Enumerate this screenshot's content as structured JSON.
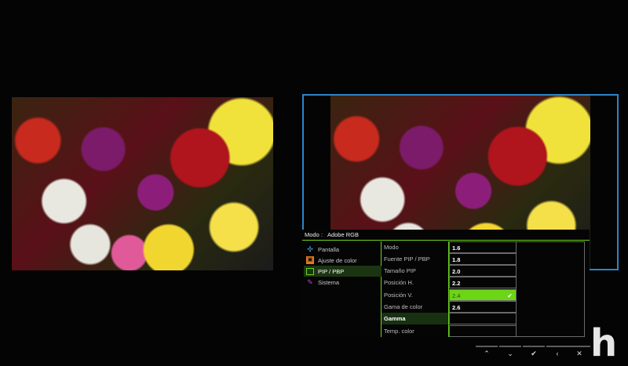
{
  "osd": {
    "mode_label": "Modo :",
    "mode_value": "Adobe RGB",
    "categories": [
      {
        "label": "Pantalla",
        "icon": "move-icon",
        "color": "#3ea6e8"
      },
      {
        "label": "Ajuste de color",
        "icon": "color-adjust-icon",
        "color": "#e07a1e"
      },
      {
        "label": "PIP / PBP",
        "icon": "pip-icon",
        "color": "#6bd51b"
      },
      {
        "label": "Sistema",
        "icon": "wrench-icon",
        "color": "#c040c8"
      }
    ],
    "submenu": [
      "Modo",
      "Fuente PIP / PBP",
      "Tamaño PIP",
      "Posición H.",
      "Posición V.",
      "Gama de color",
      "Gamma",
      "Temp. color"
    ],
    "values": [
      "1.6",
      "1.8",
      "2.0",
      "2.2",
      "2.4",
      "2.6"
    ],
    "selected_value": "2.4",
    "checkmark": "✔"
  },
  "nav_buttons": [
    {
      "glyph": "⌃"
    },
    {
      "glyph": "⌄"
    },
    {
      "glyph": "✔"
    },
    {
      "glyph": "‹"
    },
    {
      "glyph": "✕"
    }
  ],
  "watermark": "h",
  "colors": {
    "accent_green": "#6bd51b",
    "pip_border": "#2a86c9",
    "selected_fill": "#6cd516"
  }
}
